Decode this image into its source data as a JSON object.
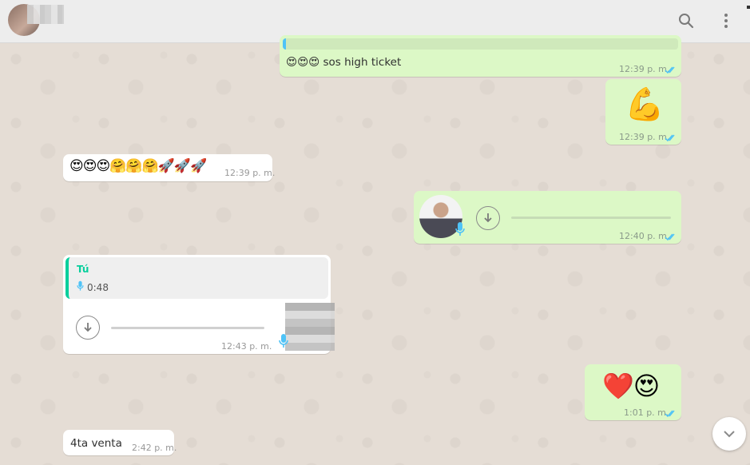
{
  "header": {
    "search_icon": "search-icon",
    "menu_icon": "kebab-menu-icon"
  },
  "messages": [
    {
      "type": "text",
      "direction": "out",
      "text": "😍😍😍 sos high ticket",
      "time": "12:39 p. m.",
      "status": "read"
    },
    {
      "type": "emoji",
      "direction": "out",
      "text": "💪",
      "time": "12:39 p. m.",
      "status": "read"
    },
    {
      "type": "emoji",
      "direction": "in",
      "text": "😍😍😍🤗🤗🤗🚀🚀🚀",
      "time": "12:39 p. m."
    },
    {
      "type": "voice",
      "direction": "out",
      "time": "12:40 p. m.",
      "status": "read"
    },
    {
      "type": "voice_reply",
      "direction": "in",
      "quote_author": "Tú",
      "quote_duration": "0:48",
      "time": "12:43 p. m."
    },
    {
      "type": "emoji",
      "direction": "out",
      "text": "❤️😍",
      "time": "1:01 p. m.",
      "status": "read"
    },
    {
      "type": "text",
      "direction": "in",
      "text": "4ta venta",
      "time": "2:42 p. m."
    }
  ],
  "colors": {
    "outgoing_bubble": "#dcf8c6",
    "incoming_bubble": "#ffffff",
    "read_ticks": "#4fc3f7",
    "quote_bar": "#06cf9c",
    "chat_background": "#e5ddd5"
  }
}
